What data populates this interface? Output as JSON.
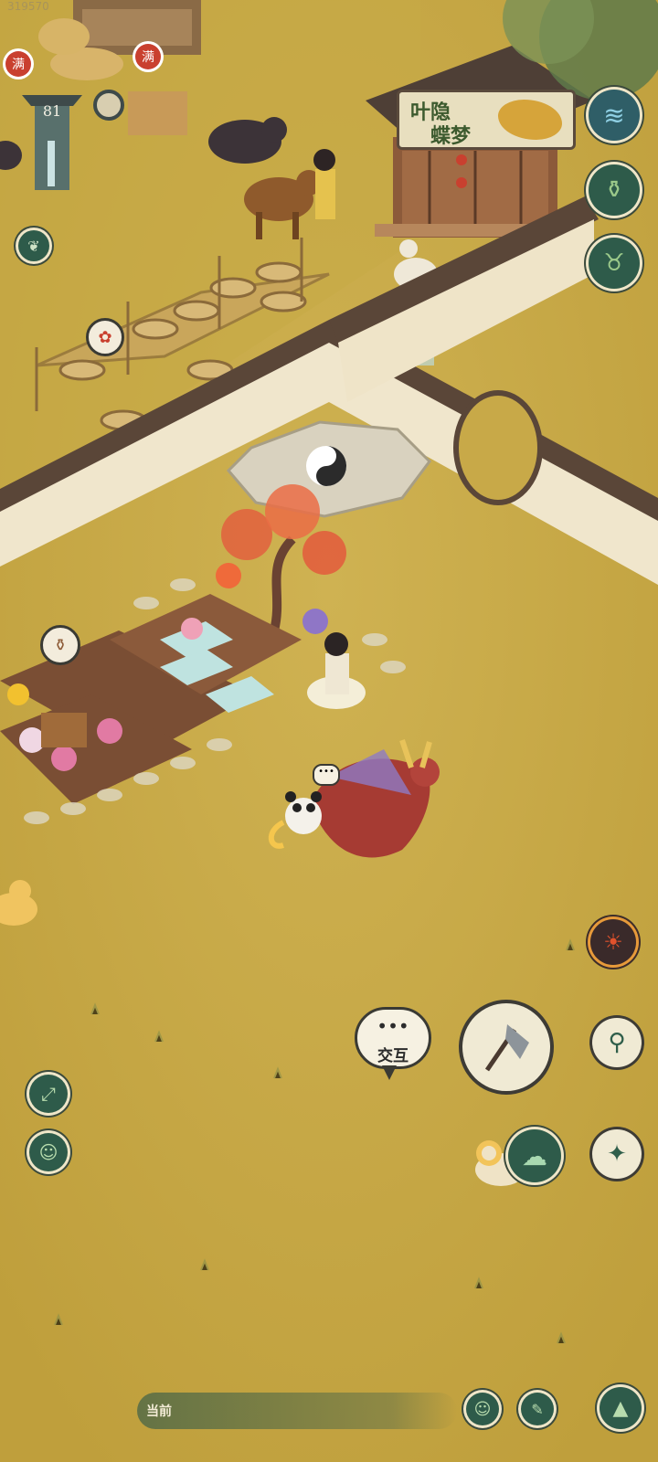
{
  "hud": {
    "top_left_id": "319570",
    "level": "81",
    "full_badge_1": "满",
    "full_badge_2": "满"
  },
  "banner": {
    "line1": "叶隐",
    "line2": "蝶梦"
  },
  "actions": {
    "interact_label": "交互",
    "chat_bubble": "•••"
  },
  "bottom_bar": {
    "current_label": "当前"
  },
  "icons": [
    "wave-icon",
    "jar-icon",
    "mask-icon",
    "leaf-icon",
    "fire-spirit-icon",
    "axe-icon",
    "net-icon",
    "cloud-icon",
    "compass-icon",
    "expand-icon",
    "portrait-icon",
    "smile-icon",
    "emote-icon",
    "chevron-up-icon"
  ],
  "colors": {
    "ground": "#c8a948",
    "wall_roof": "#5a4638",
    "wall_plaster": "#f0e6cc",
    "button_teal": "#2e5b4a",
    "button_ring": "#efe6c8"
  }
}
